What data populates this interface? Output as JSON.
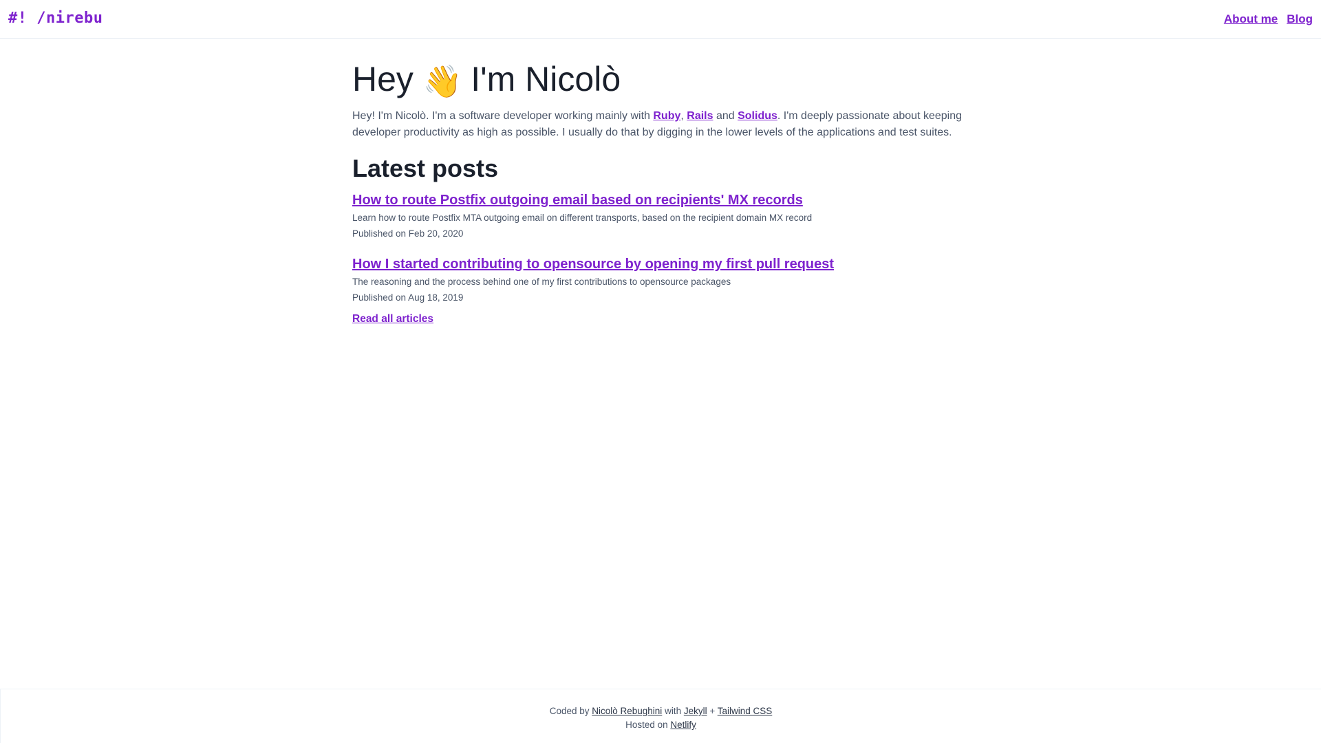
{
  "header": {
    "logo": "#! /nirebu",
    "nav": [
      {
        "label": "About me"
      },
      {
        "label": "Blog"
      }
    ]
  },
  "hero": {
    "title_before": "Hey",
    "wave_emoji": "👋",
    "title_after": "I'm Nicolò",
    "intro_prefix": "Hey! I'm Nicolò. I'm a software developer working mainly with ",
    "link_ruby": "Ruby",
    "sep_comma": ", ",
    "link_rails": "Rails",
    "sep_and": " and ",
    "link_solidus": "Solidus",
    "intro_suffix": ". I'm deeply passionate about keeping developer productivity as high as possible. I usually do that by digging in the lower levels of the applications and test suites."
  },
  "posts": {
    "heading": "Latest posts",
    "items": [
      {
        "title": "How to route Postfix outgoing email based on recipients' MX records",
        "description": "Learn how to route Postfix MTA outgoing email on different transports, based on the recipient domain MX record",
        "date": "Published on Feb 20, 2020"
      },
      {
        "title": "How I started contributing to opensource by opening my first pull request",
        "description": "The reasoning and the process behind one of my first contributions to opensource packages",
        "date": "Published on Aug 18, 2019"
      }
    ],
    "read_all": "Read all articles"
  },
  "footer": {
    "coded_by": "Coded by ",
    "author": "Nicolò Rebughini",
    "with": " with ",
    "jekyll": "Jekyll",
    "plus": " + ",
    "tailwind": "Tailwind CSS",
    "hosted_on": "Hosted on ",
    "netlify": "Netlify"
  },
  "colors": {
    "accent": "#7e22ce",
    "heading": "#1a202c",
    "body_text": "#4a5568",
    "border": "#e2e8f0"
  }
}
